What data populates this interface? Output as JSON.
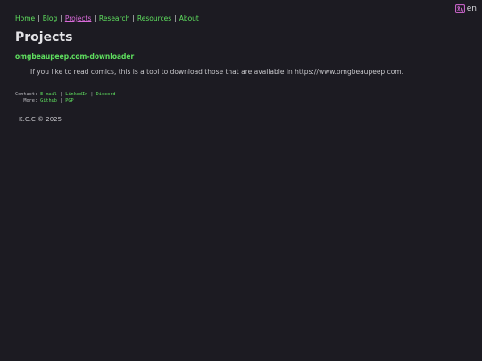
{
  "lang": {
    "code": "en",
    "icon": "translate-icon",
    "accent": "#d86ad8"
  },
  "nav": {
    "items": [
      {
        "label": "Home"
      },
      {
        "label": "Blog"
      },
      {
        "label": "Projects",
        "active": true
      },
      {
        "label": "Research"
      },
      {
        "label": "Resources"
      },
      {
        "label": "About"
      }
    ],
    "separator": "|"
  },
  "page_title": "Projects",
  "project": {
    "title": "omgbeaupeep.com-downloader",
    "description": "If you like to read comics, this is a tool to download those that are available in https://www.omgbeaupeep.com."
  },
  "contact": {
    "contact_label": "Contact:",
    "more_label": "More:",
    "contact_links": [
      "E-mail",
      "LinkedIn",
      "Discord"
    ],
    "more_links": [
      "Github",
      "PGP"
    ],
    "separator": "|"
  },
  "footer": {
    "copyright": "K.C.C © 2025"
  },
  "colors": {
    "background": "#1c1b22",
    "link": "#5fe05f",
    "active_link": "#d86ad8",
    "text": "#c8c8cc"
  }
}
